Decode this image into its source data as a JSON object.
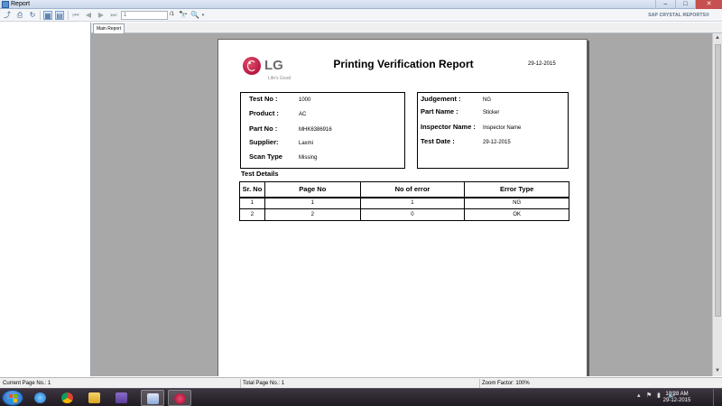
{
  "window": {
    "title": "Report",
    "controls": {
      "minimize": "–",
      "maximize": "□",
      "close": "✕"
    }
  },
  "toolbar": {
    "page_input_value": "1",
    "page_total": "/1",
    "brand": "SAP CRYSTAL REPORTS®",
    "icons": [
      "export-icon",
      "print-icon",
      "refresh-icon",
      "toggle-group-tree-icon",
      "toggle-parameter-panel-icon",
      "first-page-icon",
      "previous-page-icon",
      "next-page-icon",
      "last-page-icon",
      "find-icon",
      "zoom-icon"
    ]
  },
  "tabs": [
    {
      "label": "Main Report"
    }
  ],
  "report": {
    "logo": {
      "brand": "LG",
      "tagline": "Life's Good"
    },
    "title": "Printing Verification Report",
    "date": "29-12-2015",
    "left_fields": [
      {
        "label": "Test No :",
        "value": "1000"
      },
      {
        "label": "Product :",
        "value": "AC"
      },
      {
        "label": "Part No :",
        "value": "MHK6386916"
      },
      {
        "label": "Supplier:",
        "value": "Laxmi"
      },
      {
        "label": "Scan Type",
        "value": "Missing"
      }
    ],
    "right_fields": [
      {
        "label": "Judgement :",
        "value": "NG"
      },
      {
        "label": "Part Name :",
        "value": "Sticker"
      },
      {
        "label": "Inspector Name :",
        "value": "Inspector Name"
      },
      {
        "label": "Test Date :",
        "value": "29-12-2015"
      }
    ],
    "section_title": "Test Details",
    "table": {
      "headers": [
        "Sr. No",
        "Page No",
        "No of error",
        "Error Type"
      ],
      "rows": [
        [
          "1",
          "1",
          "1",
          "NG"
        ],
        [
          "2",
          "2",
          "0",
          "OK"
        ]
      ]
    }
  },
  "status": {
    "current_page": "Current Page No.: 1",
    "total_page": "Total Page No.: 1",
    "zoom": "Zoom Factor: 100%"
  },
  "taskbar": {
    "time": "10:28 AM",
    "date": "29-12-2015",
    "apps": [
      "start-button",
      "internet-explorer-icon",
      "chrome-icon",
      "file-explorer-icon",
      "visual-studio-icon",
      "report-app-icon",
      "lg-app-icon"
    ]
  }
}
